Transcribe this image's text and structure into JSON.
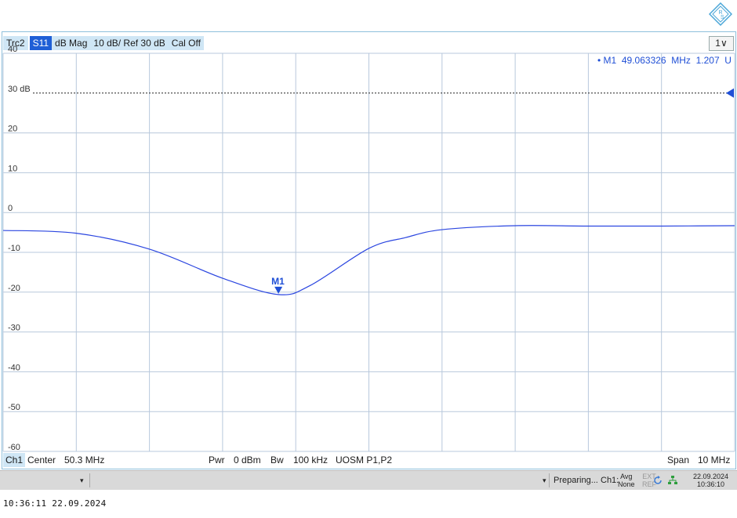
{
  "trace_bar": [
    "Trc2",
    "S11",
    "dB Mag",
    "10 dB/ Ref 30 dB",
    "Cal Off"
  ],
  "window_selector": "1∨",
  "marker_readout": "• M1  49.063326  MHz  1.207  U",
  "marker_label": "M1",
  "ref_label": "30 dB",
  "chart_data": {
    "type": "line",
    "title": "",
    "xlabel": "",
    "ylabel": "",
    "ylim": [
      -60,
      40
    ],
    "xlim": [
      45.3,
      55.3
    ],
    "x_unit": "MHz",
    "reference_line": 30,
    "y_ticks": [
      "40",
      "30 dB",
      "20",
      "10",
      "0",
      "-10",
      "-20",
      "-30",
      "-40",
      "-50",
      "-60"
    ],
    "series": [
      {
        "color": "#2b46e0",
        "x": [
          45.3,
          46.3,
          47.3,
          48.3,
          49.063,
          49.5,
          50.3,
          50.8,
          51.3,
          52.3,
          53.3,
          54.3,
          55.3
        ],
        "y": [
          -4.5,
          -5.2,
          -9.2,
          -16.5,
          -20.6,
          -18.3,
          -9.0,
          -6.3,
          -4.3,
          -3.3,
          -3.4,
          -3.4,
          -3.3
        ]
      }
    ],
    "markers": [
      {
        "name": "M1",
        "x": 49.063326,
        "y": -20.4
      }
    ]
  },
  "channel_bar": {
    "ch": "Ch1",
    "center_label": "Center",
    "center_value": "50.3 MHz",
    "pwr_label": "Pwr",
    "pwr_value": "0 dBm",
    "bw_label": "Bw",
    "bw_value": "100 kHz",
    "cal": "UOSM P1,P2",
    "span_label": "Span",
    "span_value": "10 MHz"
  },
  "status_bar": {
    "dropdown_arrow": "▾",
    "warning_arrow": "▾",
    "preparing": "Preparing...",
    "ch1": "Ch1:",
    "avg_top": "Avg",
    "avg_bottom": "None",
    "ext_top": "EXT",
    "ext_bottom": "REF",
    "date": "22.09.2024",
    "time": "10:36:10"
  },
  "footer_timestamp": "10:36:11  22.09.2024"
}
